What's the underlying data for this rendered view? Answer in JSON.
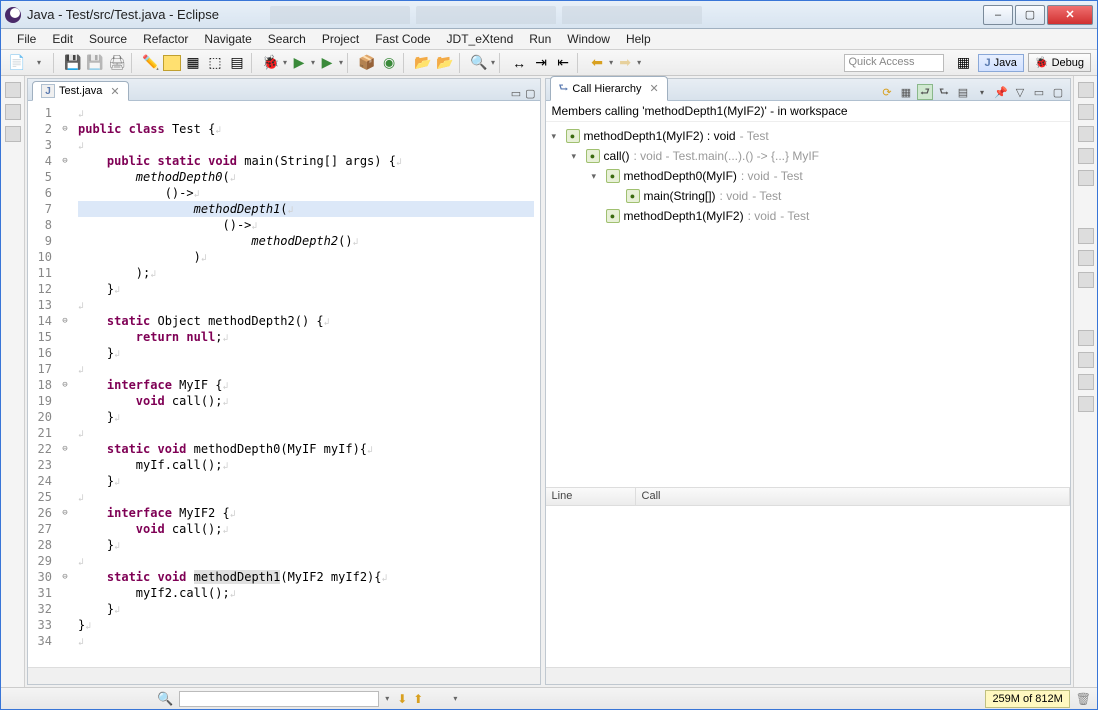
{
  "window": {
    "title": "Java - Test/src/Test.java - Eclipse"
  },
  "win_controls": {
    "min": "–",
    "max": "▢",
    "close": "✕"
  },
  "menu": [
    "File",
    "Edit",
    "Source",
    "Refactor",
    "Navigate",
    "Search",
    "Project",
    "Fast Code",
    "JDT_eXtend",
    "Run",
    "Window",
    "Help"
  ],
  "toolbar": {
    "quick_access": "Quick Access",
    "perspectives": {
      "java": "Java",
      "debug": "Debug"
    }
  },
  "editor": {
    "tab": {
      "icon": "J",
      "name": "Test.java"
    },
    "lines": [
      {
        "n": 1,
        "fold": "",
        "txt": ""
      },
      {
        "n": 2,
        "fold": "⊖",
        "txt": "<span class='kw'>public</span> <span class='kw'>class</span> Test {"
      },
      {
        "n": 3,
        "fold": "",
        "txt": ""
      },
      {
        "n": 4,
        "fold": "⊖",
        "txt": "    <span class='kw'>public</span> <span class='kw'>static</span> <span class='kw'>void</span> main(String[] args) {"
      },
      {
        "n": 5,
        "fold": "",
        "txt": "        <span class='mth'>methodDepth0</span>("
      },
      {
        "n": 6,
        "fold": "",
        "txt": "            ()-&gt;"
      },
      {
        "n": 7,
        "fold": "",
        "txt": "                <span class='mth'>methodDepth1</span>(",
        "hl": true
      },
      {
        "n": 8,
        "fold": "",
        "txt": "                    ()-&gt;"
      },
      {
        "n": 9,
        "fold": "",
        "txt": "                        <span class='mth'>methodDepth2</span>()"
      },
      {
        "n": 10,
        "fold": "",
        "txt": "                )"
      },
      {
        "n": 11,
        "fold": "",
        "txt": "        );"
      },
      {
        "n": 12,
        "fold": "",
        "txt": "    }"
      },
      {
        "n": 13,
        "fold": "",
        "txt": ""
      },
      {
        "n": 14,
        "fold": "⊖",
        "txt": "    <span class='kw'>static</span> Object methodDepth2() {"
      },
      {
        "n": 15,
        "fold": "",
        "txt": "        <span class='kw'>return</span> <span class='kw'>null</span>;"
      },
      {
        "n": 16,
        "fold": "",
        "txt": "    }"
      },
      {
        "n": 17,
        "fold": "",
        "txt": ""
      },
      {
        "n": 18,
        "fold": "⊖",
        "txt": "    <span class='kw'>interface</span> MyIF {"
      },
      {
        "n": 19,
        "fold": "",
        "txt": "        <span class='kw'>void</span> call();"
      },
      {
        "n": 20,
        "fold": "",
        "txt": "    }"
      },
      {
        "n": 21,
        "fold": "",
        "txt": ""
      },
      {
        "n": 22,
        "fold": "⊖",
        "txt": "    <span class='kw'>static</span> <span class='kw'>void</span> methodDepth0(MyIF myIf){"
      },
      {
        "n": 23,
        "fold": "",
        "txt": "        myIf.call();"
      },
      {
        "n": 24,
        "fold": "",
        "txt": "    }"
      },
      {
        "n": 25,
        "fold": "",
        "txt": ""
      },
      {
        "n": 26,
        "fold": "⊖",
        "txt": "    <span class='kw'>interface</span> MyIF2 {"
      },
      {
        "n": 27,
        "fold": "",
        "txt": "        <span class='kw'>void</span> call();"
      },
      {
        "n": 28,
        "fold": "",
        "txt": "    }"
      },
      {
        "n": 29,
        "fold": "",
        "txt": ""
      },
      {
        "n": 30,
        "fold": "⊖",
        "txt": "    <span class='kw'>static</span> <span class='kw'>void</span> <span class='method-hl'>methodDepth1</span>(MyIF2 myIf2){"
      },
      {
        "n": 31,
        "fold": "",
        "txt": "        myIf2.call();"
      },
      {
        "n": 32,
        "fold": "",
        "txt": "    }"
      },
      {
        "n": 33,
        "fold": "",
        "txt": "}"
      },
      {
        "n": 34,
        "fold": "",
        "txt": ""
      }
    ]
  },
  "hierarchy": {
    "tab": "Call Hierarchy",
    "info": "Members calling 'methodDepth1(MyIF2)' - in workspace",
    "tree": [
      {
        "depth": 0,
        "exp": "▾",
        "ic": "ic-method",
        "label": "methodDepth1(MyIF2) : void",
        "loc": " - Test"
      },
      {
        "depth": 1,
        "exp": "▾",
        "ic": "ic-method",
        "label": "call()",
        "sig": " : void - Test.main(...).() -> {...} MyIF"
      },
      {
        "depth": 2,
        "exp": "▾",
        "ic": "ic-method",
        "label": "methodDepth0(MyIF)",
        "sig": " : void",
        "loc": " - Test"
      },
      {
        "depth": 3,
        "exp": "",
        "ic": "ic-main",
        "label": "main(String[])",
        "sig": " : void",
        "loc": " - Test"
      },
      {
        "depth": 2,
        "exp": "",
        "ic": "ic-method",
        "label": "methodDepth1(MyIF2)",
        "sig": " : void",
        "loc": " - Test"
      }
    ],
    "cols": {
      "line": "Line",
      "call": "Call"
    }
  },
  "status": {
    "memory": "259M of 812M"
  }
}
